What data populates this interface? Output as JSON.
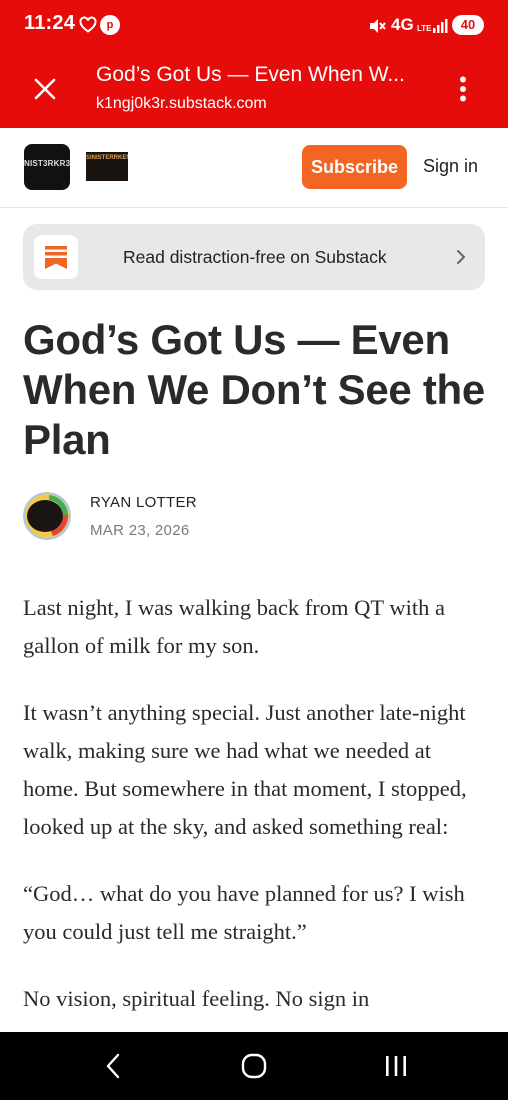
{
  "status_bar": {
    "time": "11:24",
    "app_badge": "p",
    "network": "4G",
    "network_sub": "LTE",
    "battery": "40"
  },
  "custom_tab": {
    "title": "God’s Got Us — Even When W...",
    "url": "k1ngj0k3r.substack.com",
    "close_icon": "close-icon",
    "menu_icon": "more-vert-icon"
  },
  "site_header": {
    "logo_text": "NIST3RKR3",
    "wordmark_text": "SINISTERRKEN",
    "subscribe_label": "Subscribe",
    "signin_label": "Sign in"
  },
  "app_banner": {
    "text": "Read distraction-free on Substack"
  },
  "article": {
    "title": "God’s Got Us — Even When We Don’t See the Plan",
    "author": "RYAN LOTTER",
    "date": "MAR 23, 2026",
    "paragraphs": [
      "Last night, I was walking back from QT with a gallon of milk for my son.",
      "It wasn’t anything special. Just another late-night walk, making sure we had what we needed at home. But somewhere in that moment, I stopped, looked up at the sky, and asked something real:",
      "“God… what do you have planned for us? I wish you could just tell me straight.”",
      "No vision, spiritual feeling. No sign in"
    ]
  },
  "colors": {
    "header_red": "#e60c0c",
    "subscribe_orange": "#f26522",
    "banner_gray": "#e8e8e8"
  }
}
